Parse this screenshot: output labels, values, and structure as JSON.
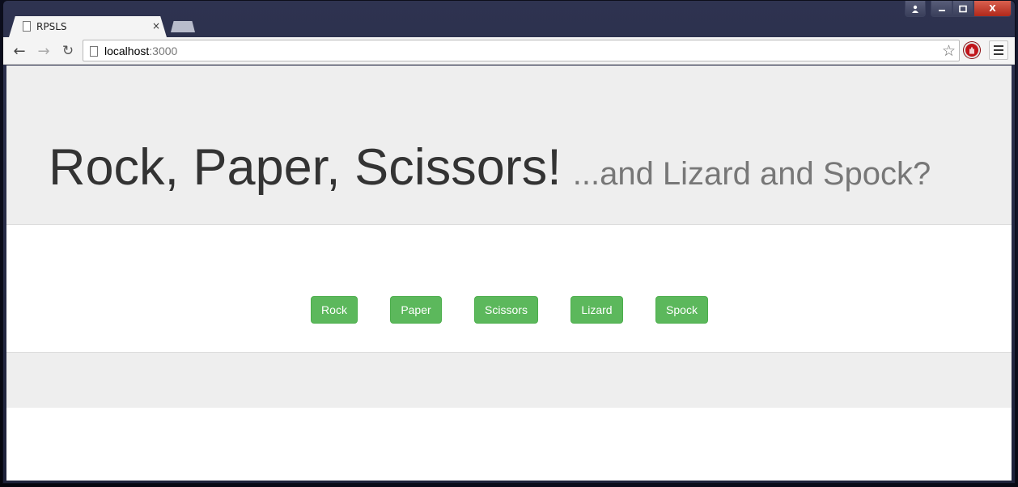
{
  "browser": {
    "tab_title": "RPSLS",
    "tab_close": "×",
    "url_host": "localhost",
    "url_port": ":3000",
    "star": "☆",
    "back": "←",
    "forward": "→",
    "reload": "↻"
  },
  "window_controls": {
    "user": "👤",
    "minimize": "▁",
    "maximize": "□",
    "close": "X"
  },
  "page": {
    "title": "Rock, Paper, Scissors!",
    "subtitle": "...and Lizard and Spock?",
    "buttons": [
      "Rock",
      "Paper",
      "Scissors",
      "Lizard",
      "Spock"
    ],
    "button_color": "#5cb85c"
  }
}
